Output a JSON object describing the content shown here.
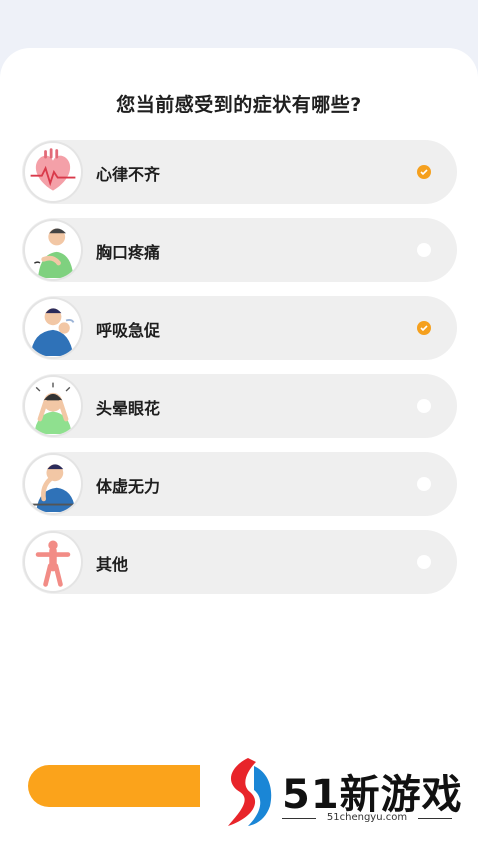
{
  "question": "您当前感受到的症状有哪些?",
  "options": [
    {
      "label": "心律不齐",
      "icon": "heart-icon",
      "selected": true
    },
    {
      "label": "胸口疼痛",
      "icon": "chest-pain-icon",
      "selected": false
    },
    {
      "label": "呼吸急促",
      "icon": "breathing-icon",
      "selected": true
    },
    {
      "label": "头晕眼花",
      "icon": "dizzy-icon",
      "selected": false
    },
    {
      "label": "体虚无力",
      "icon": "weak-icon",
      "selected": false
    },
    {
      "label": "其他",
      "icon": "body-icon",
      "selected": false
    }
  ],
  "watermark": {
    "brand": "51新游戏",
    "url": "51chengyu.com"
  },
  "colors": {
    "accent": "#f5a01e",
    "button": "#fba31b",
    "option_bg": "#efefef",
    "page_bg": "#eef1f8"
  }
}
